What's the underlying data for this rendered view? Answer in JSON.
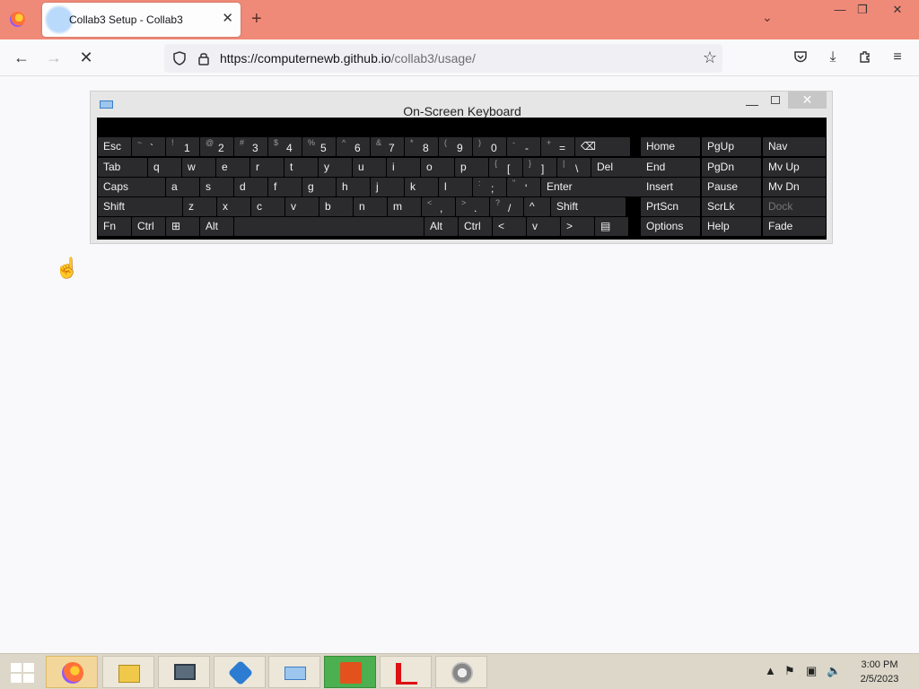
{
  "browser": {
    "tab_title": "Collab3 Setup - Collab3",
    "url_base": "https://computernewb.github.io",
    "url_path": "/collab3/usage/",
    "window_controls": {
      "minimize": "—",
      "restore": "❐",
      "close": "✕"
    }
  },
  "osk": {
    "title": "On-Screen Keyboard",
    "rows": [
      [
        {
          "id": "esc",
          "label": "Esc"
        },
        {
          "id": "tilde",
          "shift": "~",
          "main": "`"
        },
        {
          "id": "1",
          "shift": "!",
          "main": "1"
        },
        {
          "id": "2",
          "shift": "@",
          "main": "2"
        },
        {
          "id": "3",
          "shift": "#",
          "main": "3"
        },
        {
          "id": "4",
          "shift": "$",
          "main": "4"
        },
        {
          "id": "5",
          "shift": "%",
          "main": "5"
        },
        {
          "id": "6",
          "shift": "^",
          "main": "6"
        },
        {
          "id": "7",
          "shift": "&",
          "main": "7"
        },
        {
          "id": "8",
          "shift": "*",
          "main": "8"
        },
        {
          "id": "9",
          "shift": "(",
          "main": "9"
        },
        {
          "id": "0",
          "shift": ")",
          "main": "0"
        },
        {
          "id": "minus",
          "shift": "-",
          "main": "-"
        },
        {
          "id": "equals",
          "shift": "+",
          "main": "="
        },
        {
          "id": "backspace",
          "label": "⌫"
        }
      ],
      [
        {
          "id": "tab",
          "label": "Tab"
        },
        {
          "id": "q",
          "label": "q"
        },
        {
          "id": "w",
          "label": "w"
        },
        {
          "id": "e",
          "label": "e"
        },
        {
          "id": "r",
          "label": "r"
        },
        {
          "id": "t",
          "label": "t"
        },
        {
          "id": "y",
          "label": "y"
        },
        {
          "id": "u",
          "label": "u"
        },
        {
          "id": "i",
          "label": "i"
        },
        {
          "id": "o",
          "label": "o"
        },
        {
          "id": "p",
          "label": "p"
        },
        {
          "id": "lbracket",
          "shift": "{",
          "main": "["
        },
        {
          "id": "rbracket",
          "shift": "}",
          "main": "]"
        },
        {
          "id": "backslash",
          "shift": "|",
          "main": "\\"
        },
        {
          "id": "del",
          "label": "Del"
        }
      ],
      [
        {
          "id": "caps",
          "label": "Caps"
        },
        {
          "id": "a",
          "label": "a"
        },
        {
          "id": "s",
          "label": "s"
        },
        {
          "id": "d",
          "label": "d"
        },
        {
          "id": "f",
          "label": "f"
        },
        {
          "id": "g",
          "label": "g"
        },
        {
          "id": "h",
          "label": "h"
        },
        {
          "id": "j",
          "label": "j"
        },
        {
          "id": "k",
          "label": "k"
        },
        {
          "id": "l",
          "label": "l"
        },
        {
          "id": "semicolon",
          "shift": ":",
          "main": ";"
        },
        {
          "id": "quote",
          "shift": "\"",
          "main": "'"
        },
        {
          "id": "enter",
          "label": "Enter"
        }
      ],
      [
        {
          "id": "lshift",
          "label": "Shift"
        },
        {
          "id": "z",
          "label": "z"
        },
        {
          "id": "x",
          "label": "x"
        },
        {
          "id": "c",
          "label": "c"
        },
        {
          "id": "v",
          "label": "v"
        },
        {
          "id": "b",
          "label": "b"
        },
        {
          "id": "n",
          "label": "n"
        },
        {
          "id": "m",
          "label": "m"
        },
        {
          "id": "comma",
          "shift": "<",
          "main": ","
        },
        {
          "id": "period",
          "shift": ">",
          "main": "."
        },
        {
          "id": "slash",
          "shift": "?",
          "main": "/"
        },
        {
          "id": "up",
          "label": "^"
        },
        {
          "id": "rshift",
          "label": "Shift"
        }
      ],
      [
        {
          "id": "fn",
          "label": "Fn"
        },
        {
          "id": "lctrl",
          "label": "Ctrl"
        },
        {
          "id": "win",
          "label": "⊞"
        },
        {
          "id": "lalt",
          "label": "Alt"
        },
        {
          "id": "space",
          "label": ""
        },
        {
          "id": "ralt",
          "label": "Alt"
        },
        {
          "id": "rctrl",
          "label": "Ctrl"
        },
        {
          "id": "left",
          "label": "<"
        },
        {
          "id": "down",
          "label": "v"
        },
        {
          "id": "right",
          "label": ">"
        },
        {
          "id": "menu",
          "label": "▤"
        }
      ]
    ],
    "nav_keys": [
      [
        "Home",
        "PgUp",
        "Nav"
      ],
      [
        "End",
        "PgDn",
        "Mv Up"
      ],
      [
        "Insert",
        "Pause",
        "Mv Dn"
      ],
      [
        "PrtScn",
        "ScrLk",
        "Dock"
      ],
      [
        "Options",
        "Help",
        "Fade"
      ]
    ],
    "disabled_keys": [
      "Dock"
    ]
  },
  "taskbar": {
    "apps": [
      "firefox-icon",
      "file-explorer-icon",
      "computer-icon",
      "remote-desktop-icon",
      "keyboard-icon",
      "office-icon",
      "pdf-reader-icon",
      "speaker-icon"
    ],
    "time": "3:00 PM",
    "date": "2/5/2023"
  }
}
